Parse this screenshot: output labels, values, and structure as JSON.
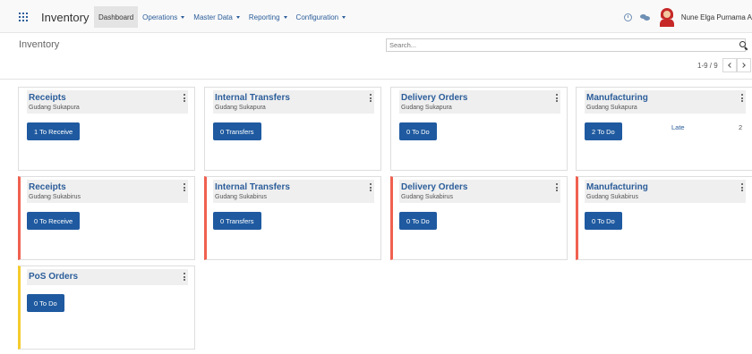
{
  "app": {
    "title": "Inventory",
    "user_name": "Nune Elga Purnama A"
  },
  "menu": [
    {
      "label": "Dashboard",
      "active": true,
      "dropdown": false
    },
    {
      "label": "Operations",
      "active": false,
      "dropdown": true
    },
    {
      "label": "Master Data",
      "active": false,
      "dropdown": true
    },
    {
      "label": "Reporting",
      "active": false,
      "dropdown": true
    },
    {
      "label": "Configuration",
      "active": false,
      "dropdown": true
    }
  ],
  "control": {
    "breadcrumb": "Inventory",
    "search_placeholder": "Search...",
    "pager": "1-9 / 9"
  },
  "colors": {
    "brand": "#2b5d9a",
    "button": "#1f5aa0",
    "tag_red": "#f06050",
    "tag_yellow": "#f4cc2c"
  },
  "cards": [
    {
      "title": "Receipts",
      "subtitle": "Gudang Sukapura",
      "button": "1 To Receive",
      "tag": "none",
      "late_label": "",
      "late_count": ""
    },
    {
      "title": "Internal Transfers",
      "subtitle": "Gudang Sukapura",
      "button": "0 Transfers",
      "tag": "none",
      "late_label": "",
      "late_count": ""
    },
    {
      "title": "Delivery Orders",
      "subtitle": "Gudang Sukapura",
      "button": "0 To Do",
      "tag": "none",
      "late_label": "",
      "late_count": ""
    },
    {
      "title": "Manufacturing",
      "subtitle": "Gudang Sukapura",
      "button": "2 To Do",
      "tag": "none",
      "late_label": "Late",
      "late_count": "2"
    },
    {
      "title": "Receipts",
      "subtitle": "Gudang Sukabirus",
      "button": "0 To Receive",
      "tag": "red",
      "late_label": "",
      "late_count": ""
    },
    {
      "title": "Internal Transfers",
      "subtitle": "Gudang Sukabirus",
      "button": "0 Transfers",
      "tag": "red",
      "late_label": "",
      "late_count": ""
    },
    {
      "title": "Delivery Orders",
      "subtitle": "Gudang Sukabirus",
      "button": "0 To Do",
      "tag": "red",
      "late_label": "",
      "late_count": ""
    },
    {
      "title": "Manufacturing",
      "subtitle": "Gudang Sukabirus",
      "button": "0 To Do",
      "tag": "red",
      "late_label": "",
      "late_count": ""
    },
    {
      "title": "PoS Orders",
      "subtitle": "",
      "button": "0 To Do",
      "tag": "yellow",
      "late_label": "",
      "late_count": ""
    }
  ]
}
